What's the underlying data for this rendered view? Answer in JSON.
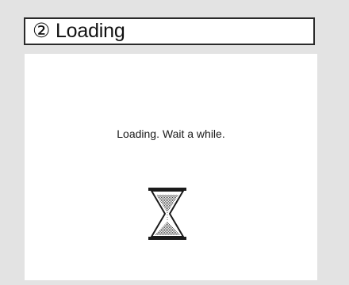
{
  "header": {
    "title": "② Loading"
  },
  "main": {
    "message": "Loading. Wait a while.",
    "icon": "hourglass-icon"
  },
  "colors": {
    "background": "#e3e3e3",
    "panel": "#ffffff",
    "border": "#2a2a2a",
    "text": "#111111"
  }
}
